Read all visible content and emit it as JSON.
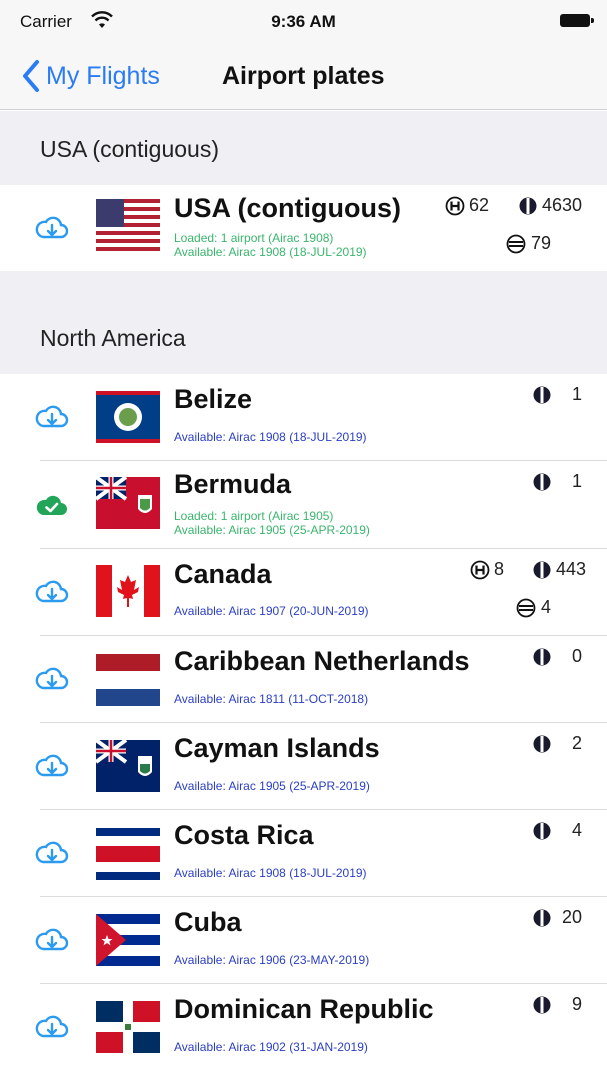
{
  "status_bar": {
    "carrier": "Carrier",
    "time": "9:36 AM"
  },
  "nav": {
    "back_label": "My Flights",
    "title": "Airport plates"
  },
  "sections": [
    {
      "header": "USA (contiguous)"
    },
    {
      "header": "North America"
    }
  ],
  "colors": {
    "accent": "#2a7cf6",
    "loaded_green": "#3ab56d",
    "available_blue": "#2b3fc2",
    "section_bg": "#efeff4"
  },
  "rows": [
    {
      "name": "USA (contiguous)",
      "icon": "cloud-download-icon",
      "loaded": "Loaded: 1 airport (Airac 1908)",
      "available": "Available: Airac 1908 (18-JUL-2019)",
      "heliports": "62",
      "airports": "4630",
      "seaplane": "79"
    },
    {
      "name": "Belize",
      "icon": "cloud-download-icon",
      "available": "Available: Airac 1908 (18-JUL-2019)",
      "airports": "1"
    },
    {
      "name": "Bermuda",
      "icon": "cloud-check-icon",
      "loaded": "Loaded: 1 airport (Airac 1905)",
      "available": "Available: Airac 1905 (25-APR-2019)",
      "airports": "1"
    },
    {
      "name": "Canada",
      "icon": "cloud-download-icon",
      "available": "Available: Airac 1907 (20-JUN-2019)",
      "heliports": "8",
      "airports": "443",
      "seaplane": "4"
    },
    {
      "name": "Caribbean Netherlands",
      "icon": "cloud-download-icon",
      "available": "Available: Airac 1811 (11-OCT-2018)",
      "airports": "0"
    },
    {
      "name": "Cayman Islands",
      "icon": "cloud-download-icon",
      "available": "Available: Airac 1905 (25-APR-2019)",
      "airports": "2"
    },
    {
      "name": "Costa Rica",
      "icon": "cloud-download-icon",
      "available": "Available: Airac 1908 (18-JUL-2019)",
      "airports": "4"
    },
    {
      "name": "Cuba",
      "icon": "cloud-download-icon",
      "available": "Available: Airac 1906 (23-MAY-2019)",
      "airports": "20"
    },
    {
      "name": "Dominican Republic",
      "icon": "cloud-download-icon",
      "available": "Available: Airac 1902 (31-JAN-2019)",
      "airports": "9"
    }
  ]
}
